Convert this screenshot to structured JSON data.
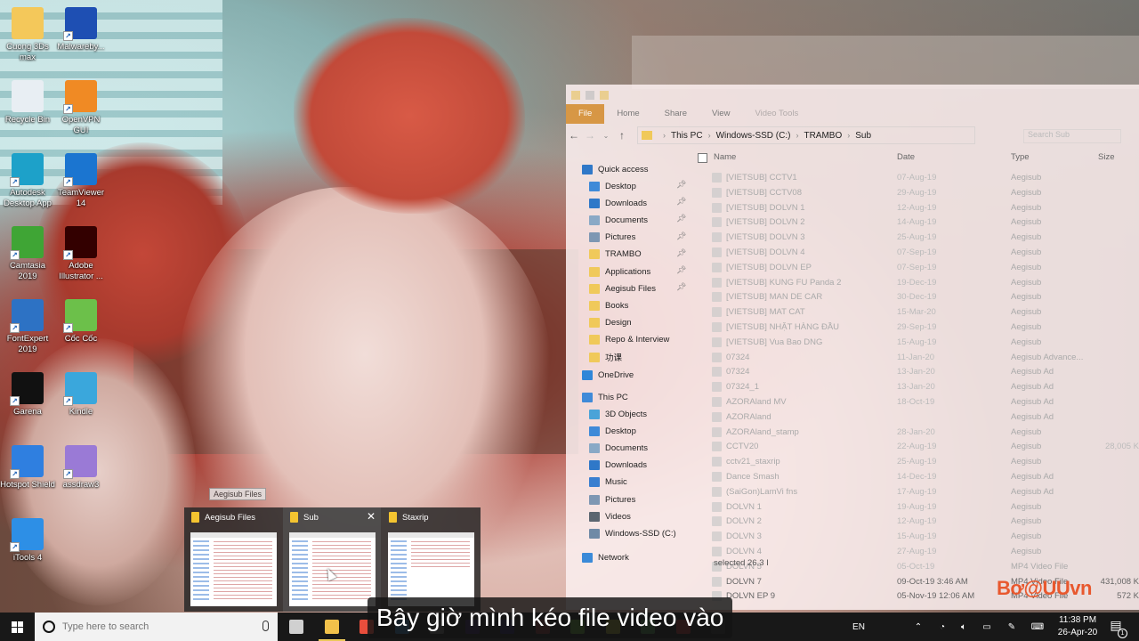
{
  "desktop": {
    "icons": [
      {
        "label": "Cuong 3Ds max",
        "icon": "folder-icon",
        "color": "#f4c85a"
      },
      {
        "label": "Malwareby...",
        "icon": "malwarebytes-icon",
        "color": "#1e4fb3"
      },
      {
        "label": "Recycle Bin",
        "icon": "recycle-bin-icon",
        "color": "#e8eef3"
      },
      {
        "label": "OpenVPN GUI",
        "icon": "openvpn-icon",
        "color": "#f08a24"
      },
      {
        "label": "Autodesk Desktop App",
        "icon": "autodesk-icon",
        "color": "#1da1c9"
      },
      {
        "label": "TeamViewer 14",
        "icon": "teamviewer-icon",
        "color": "#1b75d0"
      },
      {
        "label": "Camtasia 2019",
        "icon": "camtasia-icon",
        "color": "#3fa535"
      },
      {
        "label": "Adobe Illustrator ...",
        "icon": "illustrator-icon",
        "color": "#330000"
      },
      {
        "label": "FontExpert 2019",
        "icon": "fontexpert-icon",
        "color": "#2d72c4"
      },
      {
        "label": "Cốc Cốc",
        "icon": "coccoc-icon",
        "color": "#6cc04a"
      },
      {
        "label": "Garena",
        "icon": "garena-icon",
        "color": "#111111"
      },
      {
        "label": "Kindle",
        "icon": "kindle-icon",
        "color": "#3aa7dc"
      },
      {
        "label": "Hotspot Shield",
        "icon": "hotspot-shield-icon",
        "color": "#2f7fe0"
      },
      {
        "label": "assdraw3",
        "icon": "assdraw-icon",
        "color": "#9a7ad6"
      },
      {
        "label": "iTools 4",
        "icon": "itools-icon",
        "color": "#2d8fe6"
      }
    ]
  },
  "explorer": {
    "ribbon_tabs": [
      "File",
      "Home",
      "Share",
      "View",
      "Video Tools"
    ],
    "breadcrumb": [
      "This PC",
      "Windows-SSD (C:)",
      "TRAMBO",
      "Sub"
    ],
    "search_placeholder": "Search Sub",
    "columns": {
      "name": "Name",
      "date": "Date",
      "type": "Type",
      "size": "Size"
    },
    "nav": {
      "quick_access": "Quick access",
      "quick_items": [
        {
          "label": "Desktop",
          "icon": "desktop-icon",
          "color": "#3f8ad8",
          "pinned": true
        },
        {
          "label": "Downloads",
          "icon": "download-icon",
          "color": "#2f78c8",
          "pinned": true
        },
        {
          "label": "Documents",
          "icon": "documents-icon",
          "color": "#8aa9c6",
          "pinned": true
        },
        {
          "label": "Pictures",
          "icon": "pictures-icon",
          "color": "#7e97b3",
          "pinned": true
        },
        {
          "label": "TRAMBO",
          "icon": "folder-icon",
          "color": "#f0c95a",
          "pinned": true
        },
        {
          "label": "Applications",
          "icon": "folder-icon",
          "color": "#f0c95a",
          "pinned": true
        },
        {
          "label": "Aegisub Files",
          "icon": "folder-icon",
          "color": "#f0c95a",
          "pinned": true
        },
        {
          "label": "Books",
          "icon": "folder-icon",
          "color": "#f0c95a",
          "pinned": false
        },
        {
          "label": "Design",
          "icon": "folder-icon",
          "color": "#f0c95a",
          "pinned": false
        },
        {
          "label": "Repo & Interview",
          "icon": "folder-icon",
          "color": "#f0c95a",
          "pinned": false
        },
        {
          "label": "功课",
          "icon": "folder-icon",
          "color": "#f0c95a",
          "pinned": false
        }
      ],
      "onedrive": "OneDrive",
      "this_pc": "This PC",
      "pc_items": [
        {
          "label": "3D Objects",
          "icon": "3d-objects-icon",
          "color": "#4aa3d8"
        },
        {
          "label": "Desktop",
          "icon": "desktop-icon",
          "color": "#3f8ad8"
        },
        {
          "label": "Documents",
          "icon": "documents-icon",
          "color": "#8aa9c6"
        },
        {
          "label": "Downloads",
          "icon": "download-icon",
          "color": "#2f78c8"
        },
        {
          "label": "Music",
          "icon": "music-icon",
          "color": "#3a7fd0"
        },
        {
          "label": "Pictures",
          "icon": "pictures-icon",
          "color": "#7e97b3"
        },
        {
          "label": "Videos",
          "icon": "videos-icon",
          "color": "#5a6570"
        },
        {
          "label": "Windows-SSD (C:)",
          "icon": "drive-icon",
          "color": "#6f8aa6"
        }
      ],
      "network": "Network"
    },
    "files": [
      {
        "name": "[VIETSUB] CCTV1",
        "date": "07-Aug-19",
        "type": "Aegisub",
        "size": ""
      },
      {
        "name": "[VIETSUB] CCTV08",
        "date": "29-Aug-19",
        "type": "Aegisub",
        "size": ""
      },
      {
        "name": "[VIETSUB] DOLVN 1",
        "date": "12-Aug-19",
        "type": "Aegisub",
        "size": ""
      },
      {
        "name": "[VIETSUB] DOLVN 2",
        "date": "14-Aug-19",
        "type": "Aegisub",
        "size": ""
      },
      {
        "name": "[VIETSUB] DOLVN 3",
        "date": "25-Aug-19",
        "type": "Aegisub",
        "size": ""
      },
      {
        "name": "[VIETSUB] DOLVN 4",
        "date": "07-Sep-19",
        "type": "Aegisub",
        "size": ""
      },
      {
        "name": "[VIETSUB] DOLVN EP",
        "date": "07-Sep-19",
        "type": "Aegisub",
        "size": ""
      },
      {
        "name": "[VIETSUB] KUNG FU Panda 2",
        "date": "19-Dec-19",
        "type": "Aegisub",
        "size": ""
      },
      {
        "name": "[VIETSUB] MAN DE CAR",
        "date": "30-Dec-19",
        "type": "Aegisub",
        "size": ""
      },
      {
        "name": "[VIETSUB] MAT CAT",
        "date": "15-Mar-20",
        "type": "Aegisub",
        "size": ""
      },
      {
        "name": "[VIETSUB] NHẬT HÀNG ĐẦU",
        "date": "29-Sep-19",
        "type": "Aegisub",
        "size": ""
      },
      {
        "name": "[VIETSUB] Vua Bao DNG",
        "date": "15-Aug-19",
        "type": "Aegisub",
        "size": ""
      },
      {
        "name": "07324",
        "date": "11-Jan-20",
        "type": "Aegisub Advance...",
        "size": ""
      },
      {
        "name": "07324",
        "date": "13-Jan-20",
        "type": "Aegisub Ad",
        "size": ""
      },
      {
        "name": "07324_1",
        "date": "13-Jan-20",
        "type": "Aegisub Ad",
        "size": ""
      },
      {
        "name": "AZORAland MV",
        "date": "18-Oct-19",
        "type": "Aegisub Ad",
        "size": ""
      },
      {
        "name": "AZORAland",
        "date": "",
        "type": "Aegisub Ad",
        "size": ""
      },
      {
        "name": "AZORAland_stamp",
        "date": "28-Jan-20",
        "type": "Aegisub",
        "size": ""
      },
      {
        "name": "CCTV20",
        "date": "22-Aug-19",
        "type": "Aegisub",
        "size": "28,005 K"
      },
      {
        "name": "cctv21_staxrip",
        "date": "25-Aug-19",
        "type": "Aegisub",
        "size": ""
      },
      {
        "name": "Dance Smash",
        "date": "14-Dec-19",
        "type": "Aegisub Ad",
        "size": ""
      },
      {
        "name": "(SaiGon)LamVi fns",
        "date": "17-Aug-19",
        "type": "Aegisub Ad",
        "size": ""
      },
      {
        "name": "DOLVN 1",
        "date": "19-Aug-19",
        "type": "Aegisub",
        "size": ""
      },
      {
        "name": "DOLVN 2",
        "date": "12-Aug-19",
        "type": "Aegisub",
        "size": ""
      },
      {
        "name": "DOLVN 3",
        "date": "15-Aug-19",
        "type": "Aegisub",
        "size": ""
      },
      {
        "name": "DOLVN 4",
        "date": "27-Aug-19",
        "type": "Aegisub",
        "size": ""
      },
      {
        "name": "DOLVN 5",
        "date": "05-Oct-19",
        "type": "MP4 Video File",
        "size": ""
      },
      {
        "name": "DOLVN 7",
        "date": "09-Oct-19 3:46 AM",
        "type": "MP4 Video File",
        "size": "431,008 K"
      },
      {
        "name": "DOLVN EP 9",
        "date": "05-Nov-19 12:06 AM",
        "type": "MP4 Video File",
        "size": "572 K"
      }
    ],
    "status": "selected 26.3 I"
  },
  "watermark": "Bơ@UUvn",
  "taskbar_preview": {
    "tooltip": "Aegisub Files",
    "windows": [
      {
        "title": "Aegisub Files"
      },
      {
        "title": "Sub",
        "close": "✕"
      },
      {
        "title": "Staxrip"
      }
    ]
  },
  "subtitle": "Bây giờ mình kéo file video vào",
  "taskbar": {
    "search_placeholder": "Type here to search",
    "apps": [
      {
        "name": "task-view",
        "color": "#d0d0d0"
      },
      {
        "name": "file-explorer",
        "color": "#f2c14a"
      },
      {
        "name": "microsoft-store",
        "color": "#e94e3c"
      },
      {
        "name": "lightroom",
        "color": "#2b5f8a"
      },
      {
        "name": "sublime",
        "color": "#555555"
      },
      {
        "name": "premiere-pro",
        "color": "#2a1a4a"
      },
      {
        "name": "after-effects",
        "color": "#201a4a"
      },
      {
        "name": "davinci",
        "color": "#6a2a2a"
      },
      {
        "name": "checkmark-app",
        "color": "#4a7a2a"
      },
      {
        "name": "notes",
        "color": "#7a7a2a"
      },
      {
        "name": "camtasia",
        "color": "#3a6a3a"
      },
      {
        "name": "camtasia-recorder",
        "color": "#8a2a2a"
      },
      {
        "name": "clapper",
        "color": "#2a2a2a"
      }
    ],
    "language": "EN",
    "clock_time": "11:38 PM",
    "clock_date": "26-Apr-20",
    "notification_count": "1"
  }
}
